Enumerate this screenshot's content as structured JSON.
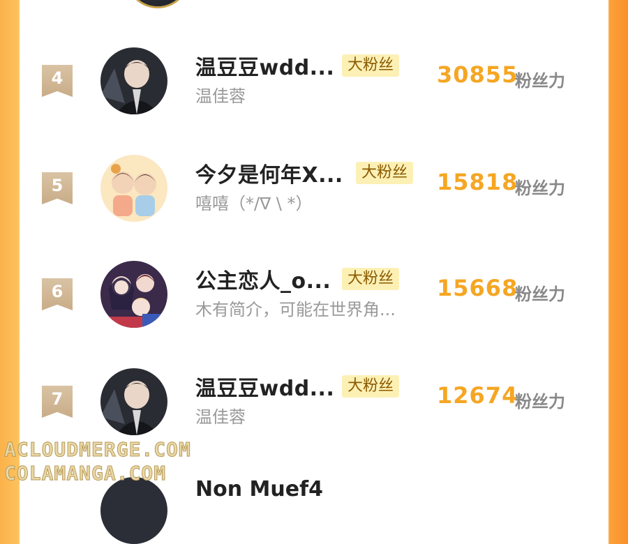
{
  "fans": [
    {
      "rank": "4",
      "name": "温豆豆wdd...",
      "badge": "大粉丝",
      "bio": "温佳蓉",
      "score": "30855",
      "unit": "粉丝力",
      "avatar_icon": "dark-suit-character-avatar"
    },
    {
      "rank": "5",
      "name": "今夕是何年X...",
      "badge": "大粉丝",
      "bio": "嘻嘻（*/∇ \\ *）",
      "score": "15818",
      "unit": "粉丝力",
      "avatar_icon": "two-kids-cartoon-avatar"
    },
    {
      "rank": "6",
      "name": "公主恋人_o...",
      "badge": "大粉丝",
      "bio": "木有简介，可能在世界角...",
      "score": "15668",
      "unit": "粉丝力",
      "avatar_icon": "anime-girls-group-avatar"
    },
    {
      "rank": "7",
      "name": "温豆豆wdd...",
      "badge": "大粉丝",
      "bio": "温佳蓉",
      "score": "12674",
      "unit": "粉丝力",
      "avatar_icon": "dark-suit-character-avatar"
    }
  ],
  "bottom_partial": {
    "name": "Non Muef4"
  },
  "watermarks": [
    "ACLOUDMERGE.COM",
    "COLAMANGA.COM"
  ],
  "colors": {
    "score": "#f5a623",
    "badge_bg": "#fdf0b5",
    "rank_bg": "#d9c3a4",
    "side_orange": "#fca23a"
  }
}
